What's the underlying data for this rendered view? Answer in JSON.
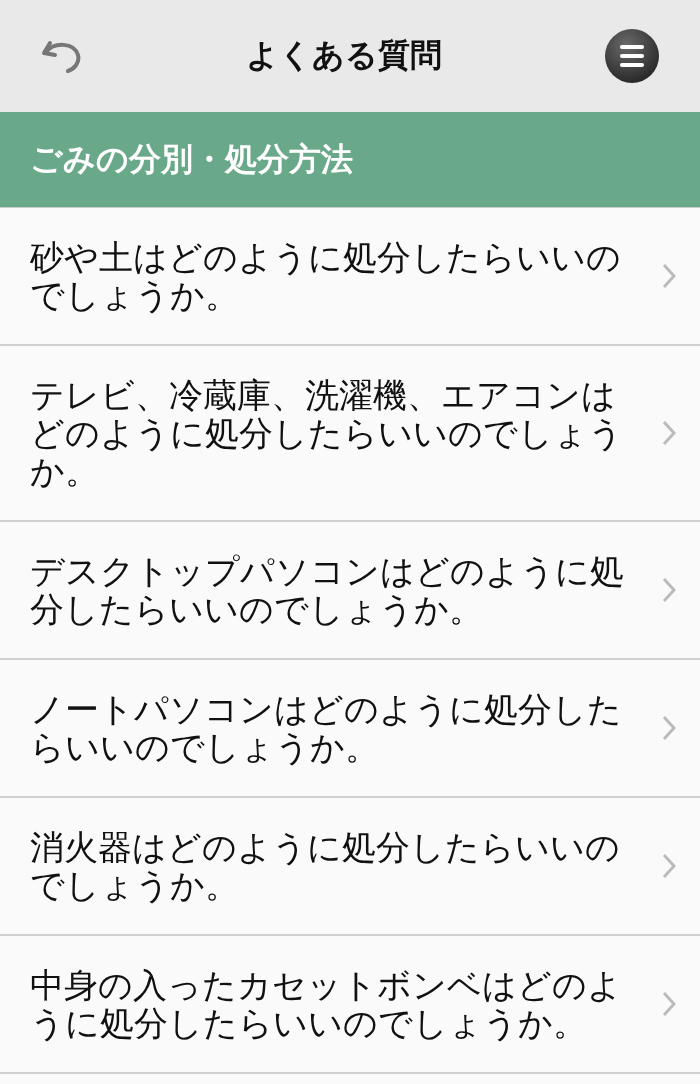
{
  "header": {
    "title": "よくある質問"
  },
  "section": {
    "title": "ごみの分別・処分方法"
  },
  "questions": [
    {
      "text": "砂や土はどのように処分したらいいのでしょうか。"
    },
    {
      "text": "テレビ、冷蔵庫、洗濯機、エアコンはどのように処分したらいいのでしょうか。"
    },
    {
      "text": "デスクトップパソコンはどのように処分したらいいのでしょうか。"
    },
    {
      "text": "ノートパソコンはどのように処分したらいいのでしょうか。"
    },
    {
      "text": "消火器はどのように処分したらいいのでしょうか。"
    },
    {
      "text": "中身の入ったカセットボンベはどのように処分したらいいのでしょうか。"
    }
  ]
}
